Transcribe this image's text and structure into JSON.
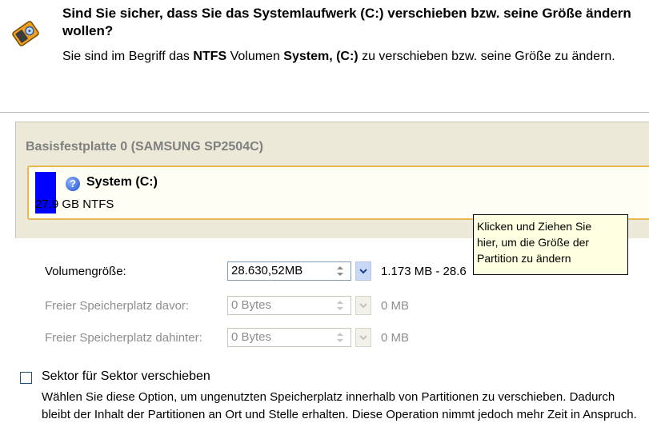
{
  "header": {
    "title": "Sind Sie sicher, dass Sie das Systemlaufwerk (C:) verschieben bzw. seine Größe ändern wollen?",
    "subtitle_pre": "Sie sind im Begriff das ",
    "subtitle_fs": "NTFS",
    "subtitle_mid": " Volumen ",
    "subtitle_vol": "System, (C:)",
    "subtitle_post": " zu verschieben bzw. seine Größe zu ändern.",
    "icon": "disk-drive-icon"
  },
  "disk": {
    "title": "Basisfestplatte 0 (SAMSUNG SP2504C)",
    "partition": {
      "name": "System (C:)",
      "size": "27.9 GB NTFS",
      "icon": "question-icon",
      "bar_color": "#0000ff"
    }
  },
  "tooltip": {
    "line1": "Klicken und Ziehen Sie",
    "line2": "hier, um die Größe der",
    "line3": "Partition zu ändern"
  },
  "fields": {
    "volume_size": {
      "label": "Volumengröße:",
      "value": "28.630,52MB",
      "range": "1.173 MB - 28.6"
    },
    "free_before": {
      "label": "Freier Speicherplatz davor:",
      "value": "0 Bytes",
      "range": "0 MB"
    },
    "free_after": {
      "label": "Freier Speicherplatz dahinter:",
      "value": "0 Bytes",
      "range": "0 MB"
    }
  },
  "sector_option": {
    "label": "Sektor für Sektor verschieben",
    "checked": false,
    "description": "Wählen Sie diese Option, um ungenutzten Speicherplatz innerhalb von Partitionen zu verschieben. Dadurch bleibt der Inhalt der Partitionen an Ort und Stelle erhalten. Diese Operation nimmt jedoch mehr Zeit in Anspruch."
  },
  "colors": {
    "accent": "#e6b84f",
    "tooltip_bg": "#ffffe1",
    "panel_bg": "#ece9d8"
  }
}
